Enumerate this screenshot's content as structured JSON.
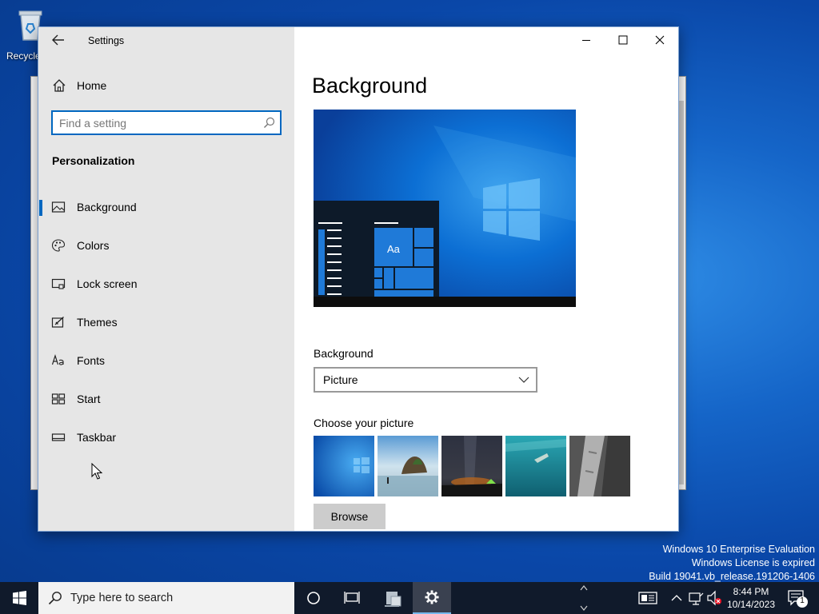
{
  "desktop": {
    "recycle_bin_label": "Recycle Bin",
    "watermark": {
      "line1": "Windows 10 Enterprise Evaluation",
      "line2": "Windows License is expired",
      "line3": "Build 19041.vb_release.191206-1406"
    }
  },
  "window": {
    "title": "Settings",
    "nav": {
      "home_label": "Home",
      "search_placeholder": "Find a setting",
      "section_title": "Personalization",
      "items": [
        {
          "label": "Background",
          "icon": "picture-icon",
          "active": true
        },
        {
          "label": "Colors",
          "icon": "palette-icon",
          "active": false
        },
        {
          "label": "Lock screen",
          "icon": "lock-screen-icon",
          "active": false
        },
        {
          "label": "Themes",
          "icon": "themes-icon",
          "active": false
        },
        {
          "label": "Fonts",
          "icon": "fonts-icon",
          "active": false
        },
        {
          "label": "Start",
          "icon": "start-icon",
          "active": false
        },
        {
          "label": "Taskbar",
          "icon": "taskbar-icon",
          "active": false
        }
      ]
    },
    "content": {
      "page_title": "Background",
      "preview_sample_text": "Aa",
      "background_label": "Background",
      "background_value": "Picture",
      "choose_label": "Choose your picture",
      "browse_label": "Browse"
    }
  },
  "taskbar": {
    "search_placeholder": "Type here to search",
    "time": "8:44 PM",
    "date": "10/14/2023",
    "notification_count": "1"
  },
  "colors": {
    "accent": "#0067c0",
    "nav_bg": "#e6e6e6",
    "taskbar_bg": "#101a2b"
  }
}
